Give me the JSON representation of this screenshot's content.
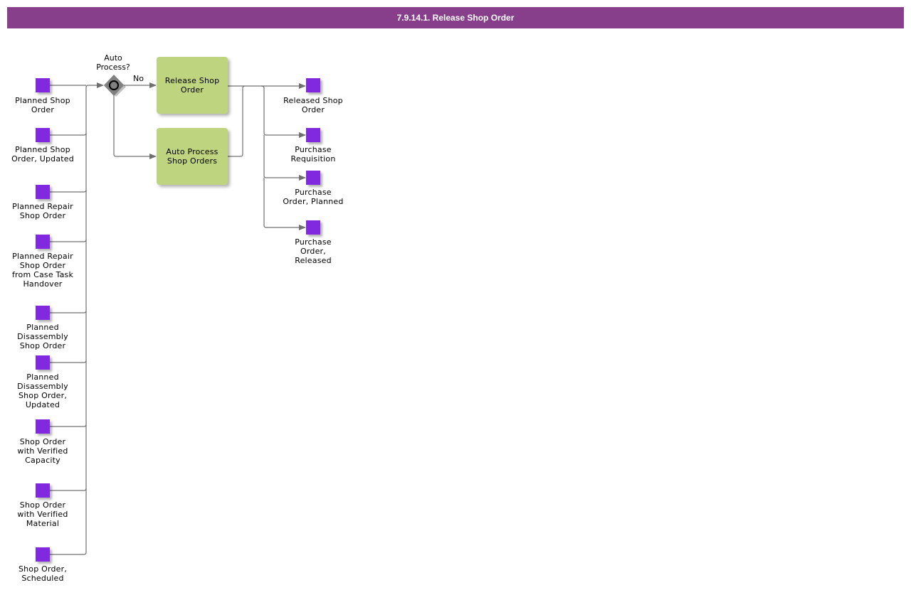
{
  "title": "7.9.14.1. Release Shop Order",
  "colors": {
    "title_bar": "#873f8c",
    "event": "#8129df",
    "task": "#bfd47f",
    "gateway": "#808080",
    "edge": "#707070"
  },
  "inputs": [
    {
      "label": "Planned Shop Order"
    },
    {
      "label": "Planned Shop Order, Updated"
    },
    {
      "label": "Planned Repair Shop Order"
    },
    {
      "label": "Planned Repair Shop Order from Case Task Handover"
    },
    {
      "label": "Planned Disassembly Shop Order"
    },
    {
      "label": "Planned Disassembly Shop Order, Updated"
    },
    {
      "label": "Shop Order with Verified Capacity"
    },
    {
      "label": "Shop Order with Verified Material"
    },
    {
      "label": "Shop Order, Scheduled"
    }
  ],
  "gateway": {
    "label": "Auto Process?",
    "icon": "exclusive-gateway-circle-icon",
    "no_label": "No"
  },
  "tasks": [
    {
      "label": "Release Shop Order"
    },
    {
      "label": "Auto Process Shop Orders"
    }
  ],
  "outputs": [
    {
      "label": "Released Shop Order"
    },
    {
      "label": "Purchase Requisition"
    },
    {
      "label": "Purchase Order, Planned"
    },
    {
      "label": "Purchase Order, Released"
    }
  ]
}
